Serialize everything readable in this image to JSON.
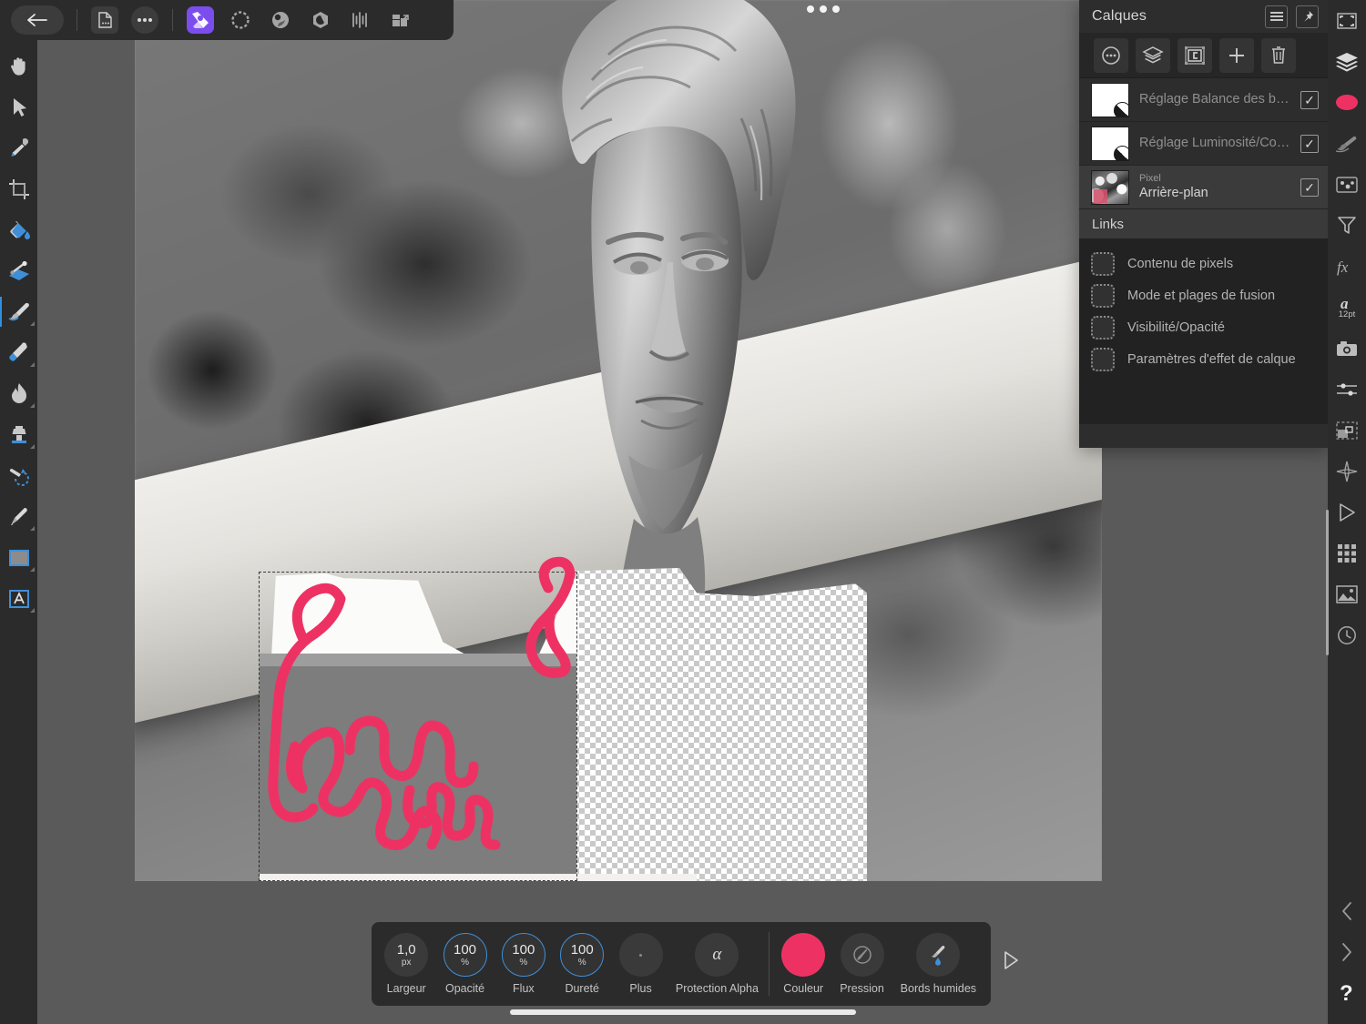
{
  "app": {
    "name": "Affinity Photo",
    "accent_purple": "#7b4dee",
    "accent_blue": "#3f8fd8",
    "brush_color": "#ED3263",
    "panel_bg": "#2d2d2d",
    "workspace_bg": "#5a5a5a"
  },
  "topbar": {
    "back_label": "back-arrow",
    "items": [
      {
        "name": "document-menu",
        "glyph": "document"
      },
      {
        "name": "more-menu",
        "glyph": "ellipsis"
      },
      {
        "name": "photo-persona",
        "glyph": "affinity-photo",
        "active": true
      },
      {
        "name": "liquify-persona",
        "glyph": "liquify"
      },
      {
        "name": "develop-persona",
        "glyph": "develop"
      },
      {
        "name": "tone-mapping-persona",
        "glyph": "tone-mapping"
      },
      {
        "name": "panorama-persona",
        "glyph": "panorama"
      },
      {
        "name": "export-persona",
        "glyph": "export"
      }
    ]
  },
  "left_tools": [
    {
      "name": "hand-tool",
      "selected": false,
      "has_flyout": false
    },
    {
      "name": "move-tool",
      "selected": false,
      "has_flyout": false
    },
    {
      "name": "color-picker-tool",
      "selected": false,
      "has_flyout": false
    },
    {
      "name": "crop-tool",
      "selected": false,
      "has_flyout": false
    },
    {
      "name": "paint-bucket-tool",
      "selected": false,
      "has_flyout": false
    },
    {
      "name": "gradient-tool",
      "selected": false,
      "has_flyout": false
    },
    {
      "name": "paint-brush-tool",
      "selected": true,
      "has_flyout": true
    },
    {
      "name": "eraser-tool",
      "selected": false,
      "has_flyout": true
    },
    {
      "name": "burn-tool",
      "selected": false,
      "has_flyout": true
    },
    {
      "name": "clone-stamp-tool",
      "selected": false,
      "has_flyout": true
    },
    {
      "name": "undo-brush-tool",
      "selected": false,
      "has_flyout": false
    },
    {
      "name": "pen-tool",
      "selected": false,
      "has_flyout": true
    },
    {
      "name": "shape-tool",
      "selected": false,
      "has_flyout": true
    },
    {
      "name": "text-tool",
      "selected": false,
      "has_flyout": true
    }
  ],
  "layers_panel": {
    "title": "Calques",
    "header_buttons": [
      {
        "name": "panel-menu-button",
        "glyph": "hamburger"
      },
      {
        "name": "pin-panel-button",
        "glyph": "pin"
      }
    ],
    "toolbar_buttons": [
      {
        "name": "layer-options-button",
        "glyph": "ellipsis-circle"
      },
      {
        "name": "merge-layers-button",
        "glyph": "layers-stack"
      },
      {
        "name": "mask-layer-button",
        "glyph": "mask"
      },
      {
        "name": "add-layer-button",
        "glyph": "plus"
      },
      {
        "name": "delete-layer-button",
        "glyph": "trash"
      }
    ],
    "layers": [
      {
        "kind": "",
        "name": "Réglage Balance des blan…",
        "thumb": "adjustment",
        "visible": true,
        "selected": false,
        "dim": true
      },
      {
        "kind": "",
        "name": "Réglage Luminosité/Contr…",
        "thumb": "adjustment",
        "visible": true,
        "selected": false,
        "dim": true
      },
      {
        "kind": "Pixel",
        "name": "Arrière-plan",
        "thumb": "photo",
        "visible": true,
        "selected": true,
        "dim": false
      }
    ],
    "links": {
      "title": "Links",
      "items": [
        {
          "label": "Contenu de pixels",
          "checked": false
        },
        {
          "label": "Mode et plages de fusion",
          "checked": false
        },
        {
          "label": "Visibilité/Opacité",
          "checked": false
        },
        {
          "label": "Paramètres d'effet de calque",
          "checked": false
        }
      ]
    }
  },
  "right_rail": [
    {
      "name": "studio-toggle-icon",
      "glyph": "fullscreen"
    },
    {
      "name": "layers-studio-icon",
      "glyph": "layers"
    },
    {
      "name": "colour-studio-icon",
      "glyph": "swatch",
      "color": "#ED3263"
    },
    {
      "name": "brushes-studio-icon",
      "glyph": "brush"
    },
    {
      "name": "swatches-studio-icon",
      "glyph": "swatches"
    },
    {
      "name": "adjustment-studio-icon",
      "glyph": "funnel"
    },
    {
      "name": "effects-studio-icon",
      "glyph": "fx"
    },
    {
      "name": "text-studio-icon",
      "glyph": "a-12pt",
      "label": "12pt"
    },
    {
      "name": "snapshot-studio-icon",
      "glyph": "camera"
    },
    {
      "name": "sliders-studio-icon",
      "glyph": "sliders"
    },
    {
      "name": "transform-studio-icon",
      "glyph": "transform"
    },
    {
      "name": "navigator-studio-icon",
      "glyph": "compass"
    },
    {
      "name": "macro-studio-icon",
      "glyph": "play"
    },
    {
      "name": "grid-studio-icon",
      "glyph": "grid"
    },
    {
      "name": "assets-studio-icon",
      "glyph": "image"
    },
    {
      "name": "history-studio-icon",
      "glyph": "clock"
    }
  ],
  "right_rail_footer": [
    {
      "name": "previous-panel-icon",
      "glyph": "chevron-left"
    },
    {
      "name": "next-panel-icon",
      "glyph": "chevron-right"
    },
    {
      "name": "help-icon",
      "glyph": "question-mark"
    }
  ],
  "context_toolbar": {
    "items": [
      {
        "name": "brush-width",
        "label": "Largeur",
        "value": "1,0",
        "unit": "px",
        "style": "plain"
      },
      {
        "name": "brush-opacity",
        "label": "Opacité",
        "value": "100",
        "unit": "%",
        "style": "ring"
      },
      {
        "name": "brush-flow",
        "label": "Flux",
        "value": "100",
        "unit": "%",
        "style": "ring"
      },
      {
        "name": "brush-hardness",
        "label": "Dureté",
        "value": "100",
        "unit": "%",
        "style": "ring"
      },
      {
        "name": "brush-more",
        "label": "Plus",
        "value": "",
        "unit": "",
        "style": "dot"
      },
      {
        "name": "alpha-protection",
        "label": "Protection Alpha",
        "value": "α",
        "unit": "",
        "style": "glyph"
      },
      {
        "name": "brush-colour",
        "label": "Couleur",
        "value": "",
        "unit": "",
        "style": "color"
      },
      {
        "name": "brush-pressure",
        "label": "Pression",
        "value": "",
        "unit": "",
        "style": "pressure"
      },
      {
        "name": "wet-edges",
        "label": "Bords humides",
        "value": "",
        "unit": "",
        "style": "wet"
      }
    ],
    "expand_arrow": "expand-toolbar-arrow"
  },
  "canvas": {
    "name": "document-canvas",
    "handle": "canvas-move-handle",
    "description": "Photographie noir et blanc d'une tête de statue sur socle, avec zone transparente en damier et traits de pinceau roses"
  }
}
